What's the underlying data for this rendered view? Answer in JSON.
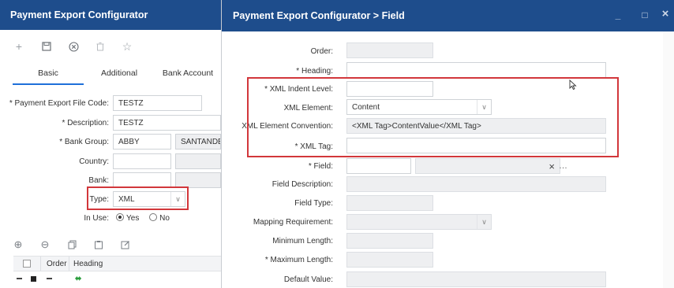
{
  "left": {
    "title": "Payment Export Configurator",
    "toolbar": {
      "add_icon": "plus-icon",
      "save_icon": "save-icon",
      "cancel_icon": "cancel-circle-icon",
      "delete_icon": "trash-icon",
      "favorite_icon": "star-icon"
    },
    "tabs": [
      "Basic",
      "Additional",
      "Bank Account"
    ],
    "fields": {
      "code_label": "* Payment Export File Code:",
      "code_value": "TESTZ",
      "desc_label": "* Description:",
      "desc_value": "TESTZ",
      "bank_group_label": "* Bank Group:",
      "bank_group_value": "ABBY",
      "bank_group_name": "SANTANDER",
      "country_label": "Country:",
      "bank_label": "Bank:",
      "type_label": "Type:",
      "type_value": "XML",
      "in_use_label": "In Use:",
      "in_use_yes": "Yes",
      "in_use_no": "No",
      "in_use_selected": "Yes"
    },
    "grid": {
      "columns": [
        "Order",
        "Heading"
      ]
    }
  },
  "right": {
    "title": "Payment Export Configurator > Field",
    "fields": {
      "order_label": "Order:",
      "heading_label": "* Heading:",
      "indent_label": "* XML Indent Level:",
      "element_label": "XML Element:",
      "element_value": "Content",
      "convention_label": "XML Element Convention:",
      "convention_value": "<XML Tag>ContentValue</XML Tag>",
      "tag_label": "* XML Tag:",
      "field_label": "* Field:",
      "field_desc_label": "Field Description:",
      "field_type_label": "Field Type:",
      "mapping_label": "Mapping Requirement:",
      "min_len_label": "Minimum Length:",
      "max_len_label": "* Maximum Length:",
      "default_label": "Default Value:"
    },
    "window_buttons": {
      "minimize": "_",
      "maximize": "□",
      "close": "×"
    }
  },
  "colors": {
    "titlebar": "#1e4d8c",
    "highlight": "#d2373b",
    "tab_underline": "#1e6fd9"
  }
}
